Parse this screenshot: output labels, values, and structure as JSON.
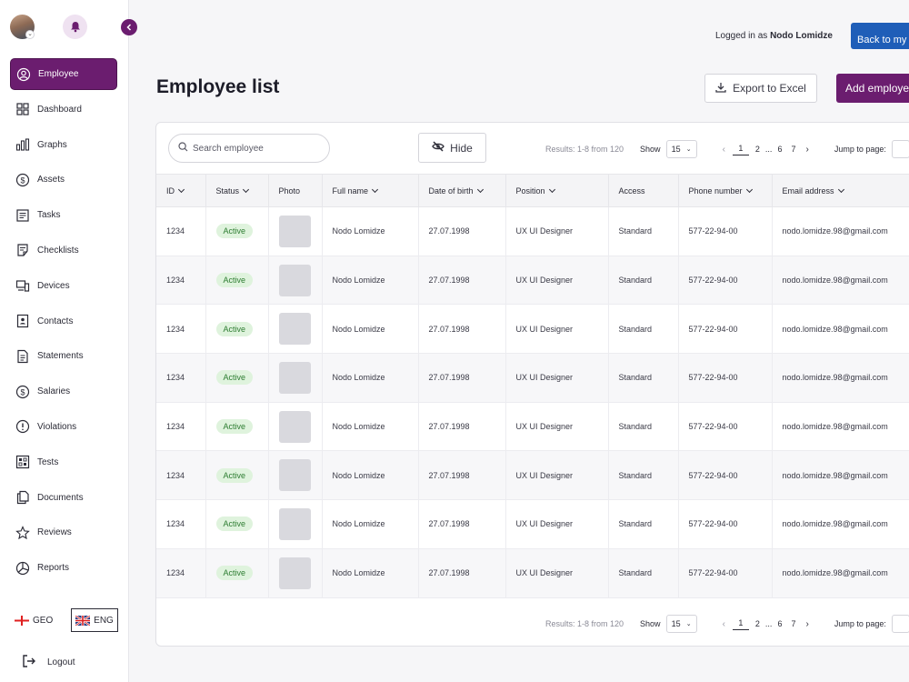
{
  "header": {
    "logged_prefix": "Logged in as",
    "user_name": "Nodo Lomidze",
    "back_label": "Back to my"
  },
  "sidebar": {
    "items": [
      {
        "label": "Employee",
        "icon": "user-circle-icon",
        "active": true
      },
      {
        "label": "Dashboard",
        "icon": "grid-icon"
      },
      {
        "label": "Graphs",
        "icon": "bar-chart-icon"
      },
      {
        "label": "Assets",
        "icon": "dollar-circle-icon"
      },
      {
        "label": "Tasks",
        "icon": "task-list-icon"
      },
      {
        "label": "Checklists",
        "icon": "checklist-icon"
      },
      {
        "label": "Devices",
        "icon": "devices-icon"
      },
      {
        "label": "Contacts",
        "icon": "contact-card-icon"
      },
      {
        "label": "Statements",
        "icon": "document-icon"
      },
      {
        "label": "Salaries",
        "icon": "dollar-circle-icon"
      },
      {
        "label": "Violations",
        "icon": "alert-circle-icon"
      },
      {
        "label": "Tests",
        "icon": "test-grid-icon"
      },
      {
        "label": "Documents",
        "icon": "documents-icon"
      },
      {
        "label": "Reviews",
        "icon": "star-icon"
      },
      {
        "label": "Reports",
        "icon": "pie-chart-icon"
      }
    ],
    "lang_geo": "GEO",
    "lang_eng": "ENG",
    "logout": "Logout"
  },
  "page": {
    "title": "Employee list",
    "export_label": "Export to Excel",
    "add_label": "Add employe"
  },
  "toolbar": {
    "search_placeholder": "Search employee",
    "hide_label": "Hide"
  },
  "pagination": {
    "results": "Results: 1-8 from 120",
    "show_label": "Show",
    "show_value": "15",
    "pages": [
      "1",
      "2",
      "...",
      "6",
      "7"
    ],
    "current_page": "1",
    "jump_label": "Jump to page:"
  },
  "table": {
    "columns": [
      "ID",
      "Status",
      "Photo",
      "Full name",
      "Date of birth",
      "Position",
      "Access",
      "Phone number",
      "Email address"
    ],
    "rows": [
      {
        "id": "1234",
        "status": "Active",
        "name": "Nodo Lomidze",
        "dob": "27.07.1998",
        "position": "UX UI Designer",
        "access": "Standard",
        "phone": "577-22-94-00",
        "email": "nodo.lomidze.98@gmail.com"
      },
      {
        "id": "1234",
        "status": "Active",
        "name": "Nodo Lomidze",
        "dob": "27.07.1998",
        "position": "UX UI Designer",
        "access": "Standard",
        "phone": "577-22-94-00",
        "email": "nodo.lomidze.98@gmail.com"
      },
      {
        "id": "1234",
        "status": "Active",
        "name": "Nodo Lomidze",
        "dob": "27.07.1998",
        "position": "UX UI Designer",
        "access": "Standard",
        "phone": "577-22-94-00",
        "email": "nodo.lomidze.98@gmail.com"
      },
      {
        "id": "1234",
        "status": "Active",
        "name": "Nodo Lomidze",
        "dob": "27.07.1998",
        "position": "UX UI Designer",
        "access": "Standard",
        "phone": "577-22-94-00",
        "email": "nodo.lomidze.98@gmail.com"
      },
      {
        "id": "1234",
        "status": "Active",
        "name": "Nodo Lomidze",
        "dob": "27.07.1998",
        "position": "UX UI Designer",
        "access": "Standard",
        "phone": "577-22-94-00",
        "email": "nodo.lomidze.98@gmail.com"
      },
      {
        "id": "1234",
        "status": "Active",
        "name": "Nodo Lomidze",
        "dob": "27.07.1998",
        "position": "UX UI Designer",
        "access": "Standard",
        "phone": "577-22-94-00",
        "email": "nodo.lomidze.98@gmail.com"
      },
      {
        "id": "1234",
        "status": "Active",
        "name": "Nodo Lomidze",
        "dob": "27.07.1998",
        "position": "UX UI Designer",
        "access": "Standard",
        "phone": "577-22-94-00",
        "email": "nodo.lomidze.98@gmail.com"
      },
      {
        "id": "1234",
        "status": "Active",
        "name": "Nodo Lomidze",
        "dob": "27.07.1998",
        "position": "UX UI Designer",
        "access": "Standard",
        "phone": "577-22-94-00",
        "email": "nodo.lomidze.98@gmail.com"
      }
    ]
  },
  "colors": {
    "brand": "#6b1d6f",
    "primary_blue": "#1f5eb8",
    "active_badge_bg": "#dff3dd",
    "active_badge_text": "#2e7d32"
  }
}
